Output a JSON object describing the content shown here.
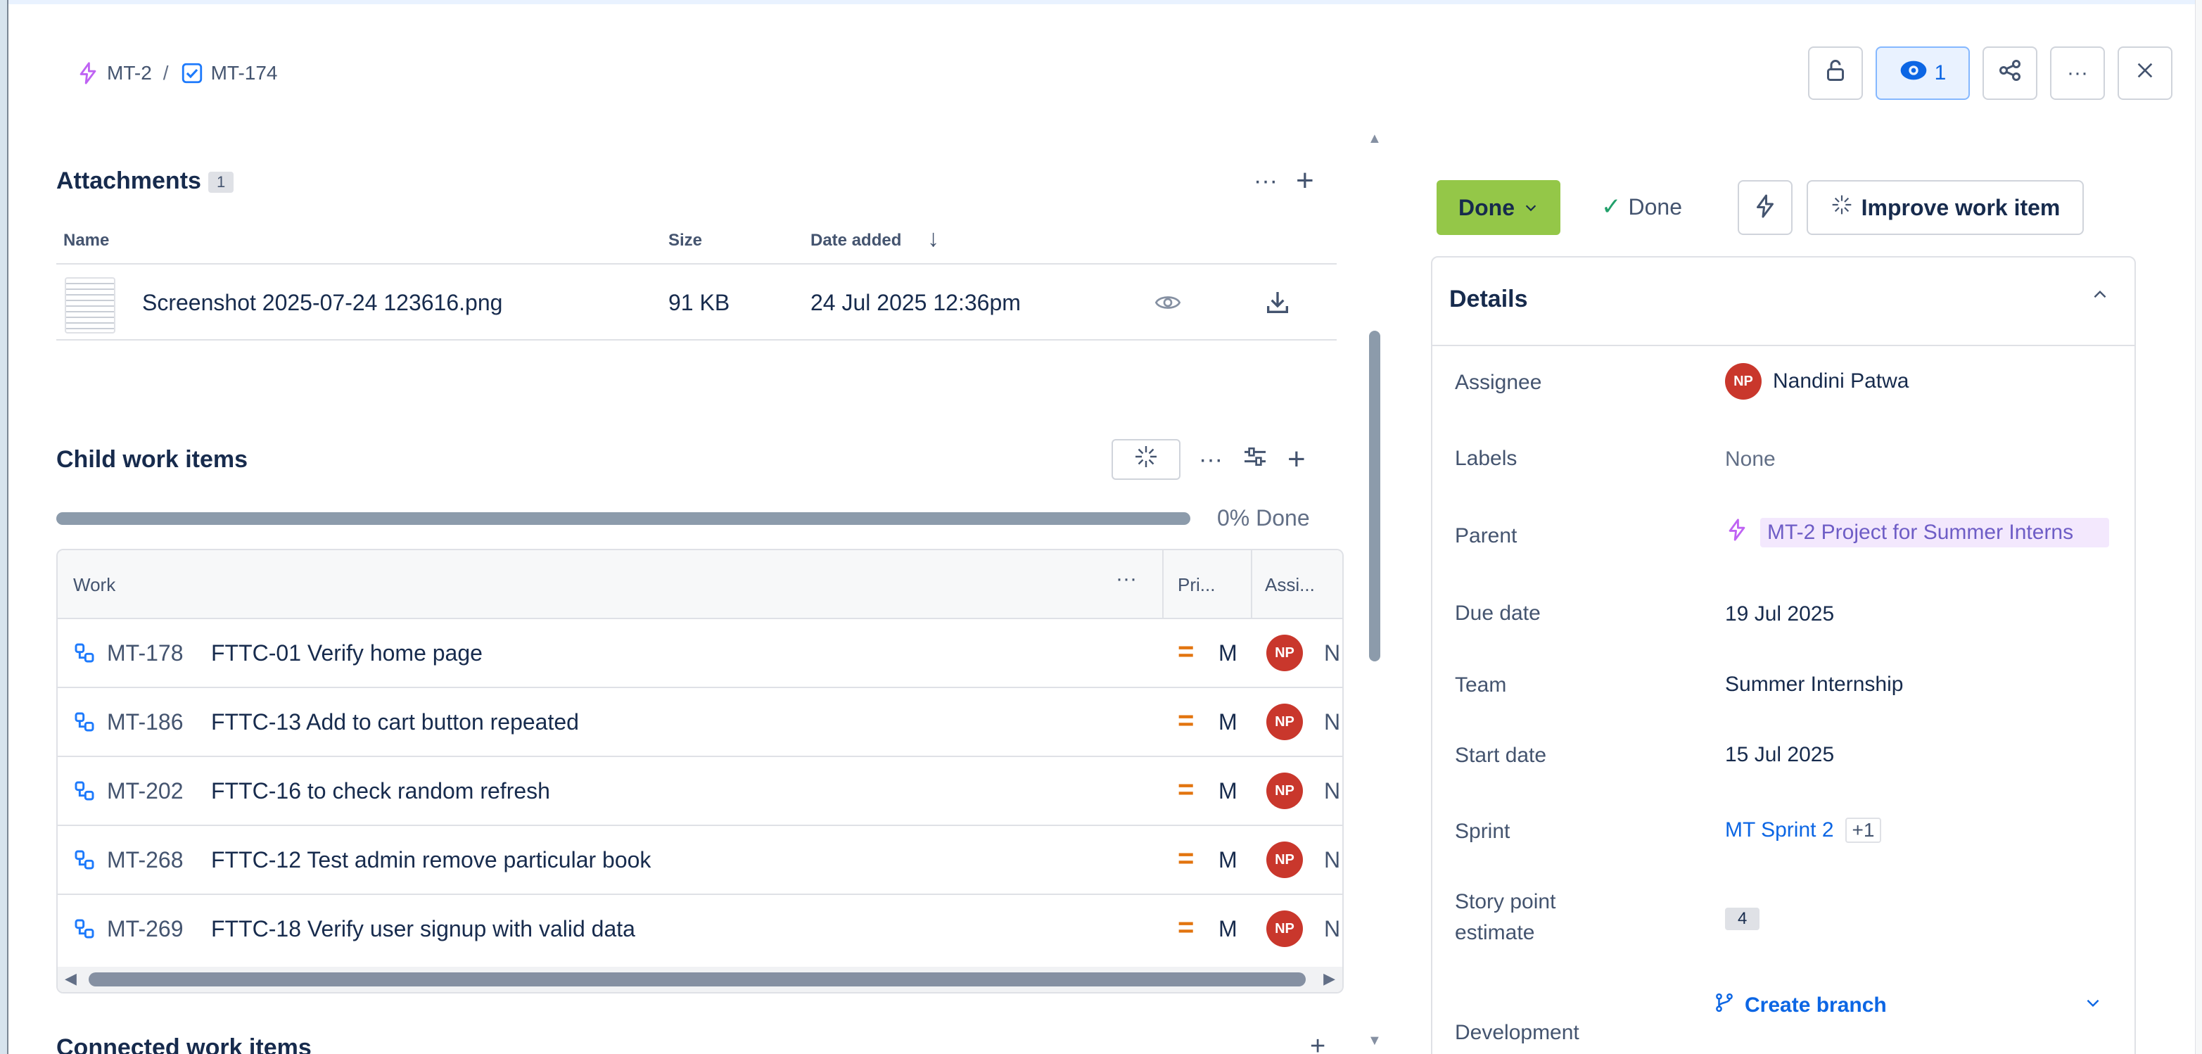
{
  "breadcrumb": {
    "parent_key": "MT-2",
    "separator": "/",
    "current_key": "MT-174"
  },
  "top_actions": {
    "watch_count": "1"
  },
  "attachments": {
    "title": "Attachments",
    "count": "1",
    "columns": {
      "name": "Name",
      "size": "Size",
      "date_added": "Date added"
    },
    "items": [
      {
        "name": "Screenshot 2025-07-24 123616.png",
        "size": "91 KB",
        "date": "24 Jul 2025 12:36pm"
      }
    ]
  },
  "child_items": {
    "title": "Child work items",
    "progress_label": "0% Done",
    "progress_fraction": 0,
    "columns": {
      "work": "Work",
      "priority": "Pri...",
      "assignee": "Assi..."
    },
    "rows": [
      {
        "key": "MT-178",
        "summary": "FTTC-01 Verify home page",
        "priority": "M",
        "assignee_initials": "NP",
        "assignee_cut": "N"
      },
      {
        "key": "MT-186",
        "summary": "FTTC-13 Add to cart button repeated",
        "priority": "M",
        "assignee_initials": "NP",
        "assignee_cut": "N"
      },
      {
        "key": "MT-202",
        "summary": "FTTC-16 to check random refresh",
        "priority": "M",
        "assignee_initials": "NP",
        "assignee_cut": "N"
      },
      {
        "key": "MT-268",
        "summary": "FTTC-12 Test admin remove particular book",
        "priority": "M",
        "assignee_initials": "NP",
        "assignee_cut": "N"
      },
      {
        "key": "MT-269",
        "summary": "FTTC-18 Verify user signup with valid data",
        "priority": "M",
        "assignee_initials": "NP",
        "assignee_cut": "N"
      }
    ]
  },
  "connected": {
    "title": "Connected work items"
  },
  "status": {
    "button_label": "Done",
    "resolution_label": "Done",
    "improve_label": "Improve work item"
  },
  "details": {
    "title": "Details",
    "assignee_label": "Assignee",
    "assignee_initials": "NP",
    "assignee_name": "Nandini Patwa",
    "labels_label": "Labels",
    "labels_value": "None",
    "parent_label": "Parent",
    "parent_value": "MT-2 Project for Summer Interns",
    "due_label": "Due date",
    "due_value": "19 Jul 2025",
    "team_label": "Team",
    "team_value": "Summer Internship",
    "start_label": "Start date",
    "start_value": "15 Jul 2025",
    "sprint_label": "Sprint",
    "sprint_value": "MT Sprint 2",
    "sprint_more": "+1",
    "story_label_1": "Story point",
    "story_label_2": "estimate",
    "story_value": "4",
    "development_label": "Development",
    "create_branch": "Create branch"
  },
  "colors": {
    "status_green": "#94c748",
    "link_blue": "#0c66e4",
    "avatar_red": "#c9372c",
    "priority_orange": "#e2740f",
    "epic_purple": "#bf63f3"
  },
  "icons": [
    "lightning-icon",
    "checkbox-icon",
    "lock-icon",
    "eye-icon",
    "share-icon",
    "more-icon",
    "close-icon",
    "plus-icon",
    "arrow-down-icon",
    "download-icon",
    "sparkle-icon",
    "filter-icon",
    "subtask-icon",
    "priority-medium-icon",
    "chevron-up-icon",
    "chevron-down-icon",
    "branch-icon",
    "check-icon"
  ]
}
